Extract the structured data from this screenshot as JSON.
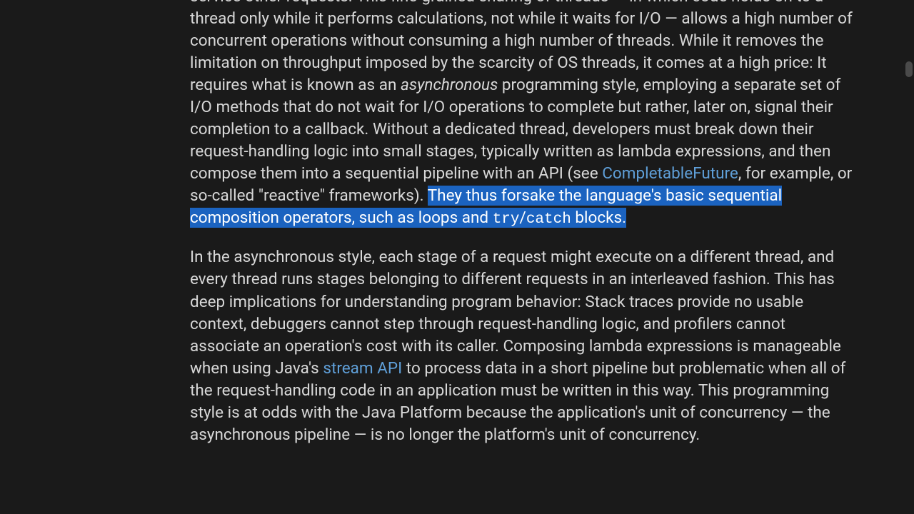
{
  "paragraph1": {
    "pre": "service other requests. This fine-grained sharing of threads — in which code holds on to a thread only while it performs calculations, not while it waits for I/O — allows a high number of concurrent operations without consuming a high number of threads. While it removes the limitation on throughput imposed by the scarcity of OS threads, it comes at a high price: It requires what is known as an ",
    "asyncWord": "asynchronous",
    "mid1": " programming style, employing a separate set of I/O methods that do not wait for I/O operations to complete but rather, later on, signal their completion to a callback. Without a dedicated thread, developers must break down their request-handling logic into small stages, typically written as lambda expressions, and then compose them into a sequential pipeline with an API (see ",
    "link1": "CompletableFuture",
    "mid2": ", for example, or so-called \"reactive\" frameworks). ",
    "hl_a": "They thus forsake the language's basic sequential composition operators, such as loops and ",
    "hl_code": "try",
    "hl_slash": "/",
    "hl_code2": "catch",
    "hl_b": " blocks."
  },
  "paragraph2": {
    "pre": "In the asynchronous style, each stage of a request might execute on a different thread, and every thread runs stages belonging to different requests in an interleaved fashion. This has deep implications for understanding program behavior: Stack traces provide no usable context, debuggers cannot step through request-handling logic, and profilers cannot associate an operation's cost with its caller. Composing lambda expressions is manageable when using Java's ",
    "link1": "stream API",
    "post": " to process data in a short pipeline but problematic when all of the request-handling code in an application must be written in this way. This programming style is at odds with the Java Platform because the application's unit of concurrency — the asynchronous pipeline — is no longer the platform's unit of concurrency."
  }
}
